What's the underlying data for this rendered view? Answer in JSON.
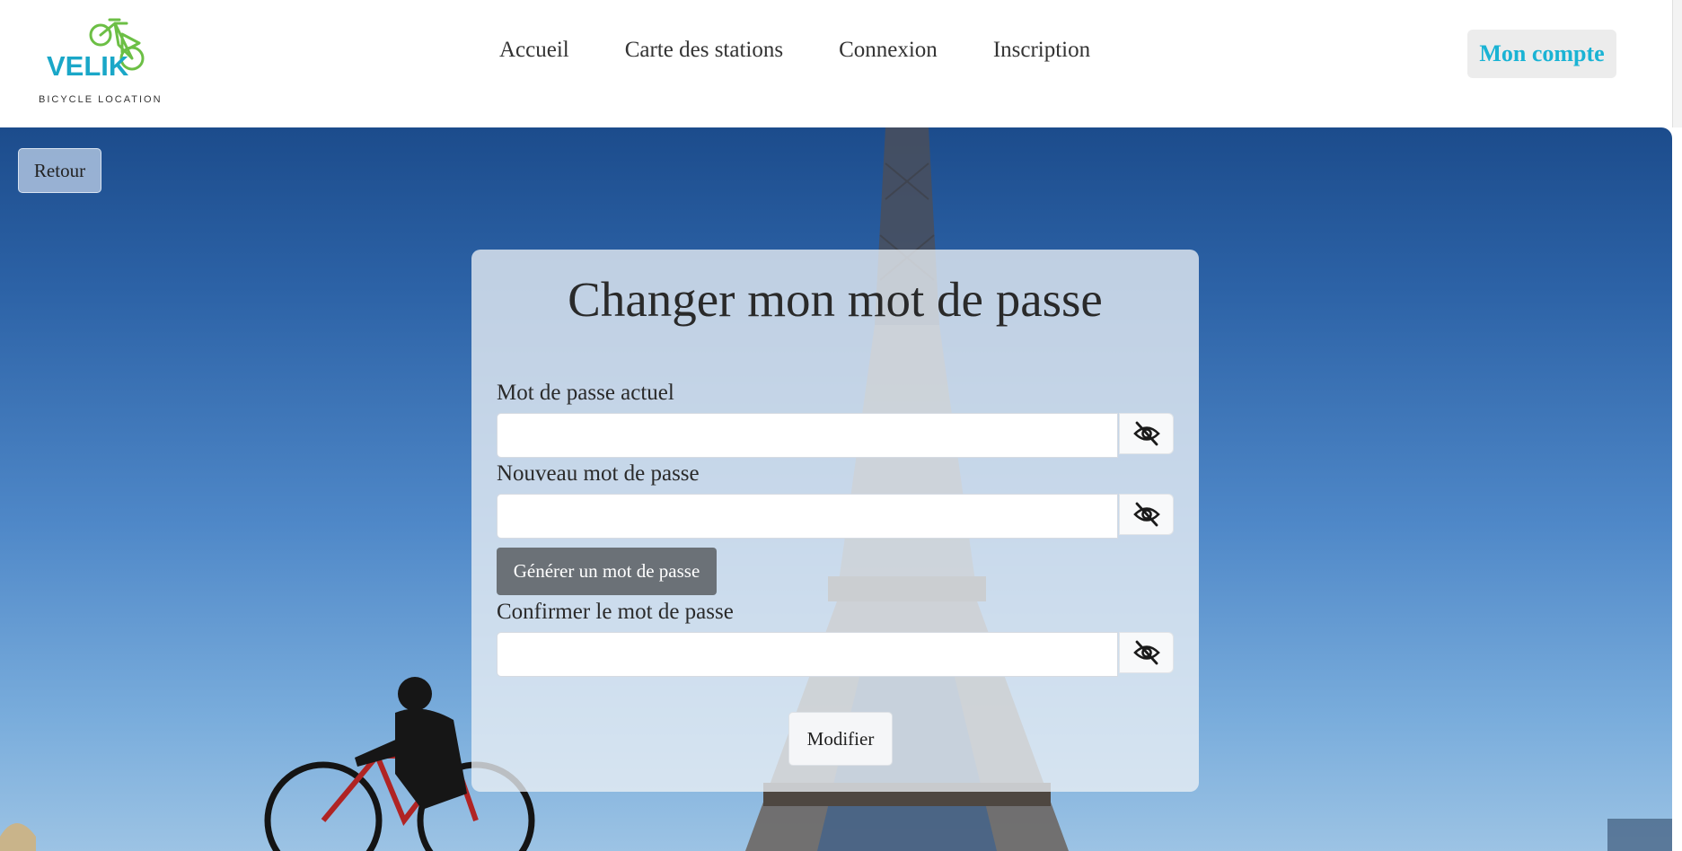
{
  "brand": {
    "name": "VELIK",
    "tagline": "BICYCLE LOCATION",
    "logo_icon": "bicycle-logo-icon",
    "accent_color": "#1aa7c8",
    "logo_color": "#6cbf45"
  },
  "nav": {
    "items": [
      {
        "label": "Accueil"
      },
      {
        "label": "Carte des stations"
      },
      {
        "label": "Connexion"
      },
      {
        "label": "Inscription"
      }
    ],
    "account_label": "Mon compte"
  },
  "back_label": "Retour",
  "form": {
    "title": "Changer mon mot de passe",
    "current_password": {
      "label": "Mot de passe actuel",
      "value": "",
      "toggle_icon": "eye-slash-icon"
    },
    "new_password": {
      "label": "Nouveau mot de passe",
      "value": "",
      "toggle_icon": "eye-slash-icon"
    },
    "generate_label": "Générer un mot de passe",
    "confirm_password": {
      "label": "Confirmer le mot de passe",
      "value": "",
      "toggle_icon": "eye-slash-icon"
    },
    "submit_label": "Modifier"
  }
}
